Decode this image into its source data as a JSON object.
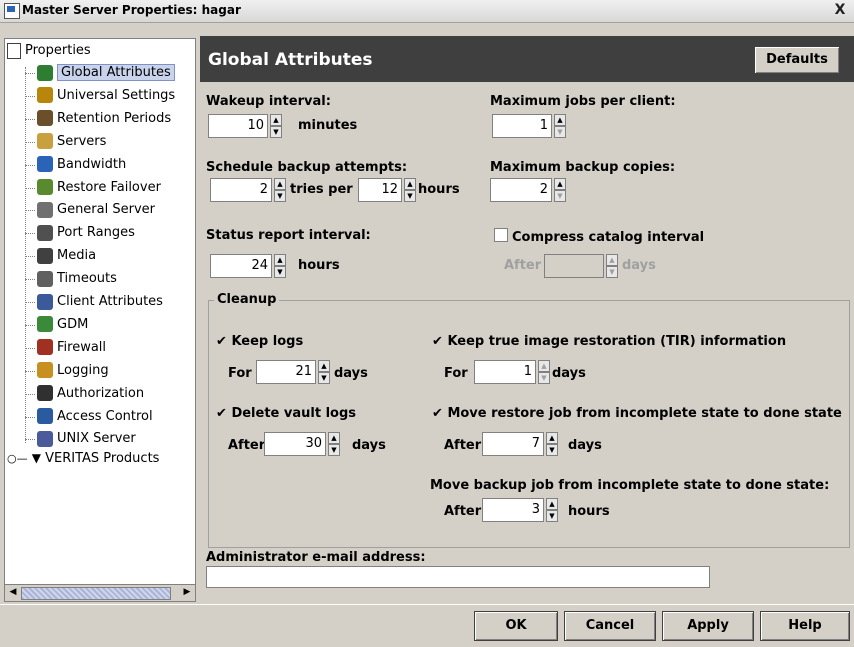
{
  "window": {
    "title": "Master Server Properties: hagar",
    "close_label": "X"
  },
  "tree": {
    "root": "Properties",
    "items": [
      {
        "label": "Global Attributes",
        "icon": "globe-icon",
        "color": "#2e7d32"
      },
      {
        "label": "Universal Settings",
        "icon": "gear-icon",
        "color": "#b8860b"
      },
      {
        "label": "Retention Periods",
        "icon": "clock-icon",
        "color": "#6b4f2a"
      },
      {
        "label": "Servers",
        "icon": "server-icon",
        "color": "#c8a040"
      },
      {
        "label": "Bandwidth",
        "icon": "bandwidth-icon",
        "color": "#2a63b7"
      },
      {
        "label": "Restore Failover",
        "icon": "failover-icon",
        "color": "#5a8a30"
      },
      {
        "label": "General Server",
        "icon": "server-icon",
        "color": "#707070"
      },
      {
        "label": "Port Ranges",
        "icon": "port-icon",
        "color": "#505050"
      },
      {
        "label": "Media",
        "icon": "media-icon",
        "color": "#404040"
      },
      {
        "label": "Timeouts",
        "icon": "timer-icon",
        "color": "#606060"
      },
      {
        "label": "Client Attributes",
        "icon": "client-icon",
        "color": "#3a5a9a"
      },
      {
        "label": "GDM",
        "icon": "gdm-icon",
        "color": "#3a8a3a"
      },
      {
        "label": "Firewall",
        "icon": "firewall-icon",
        "color": "#a03020"
      },
      {
        "label": "Logging",
        "icon": "logging-icon",
        "color": "#c89020"
      },
      {
        "label": "Authorization",
        "icon": "user-icon",
        "color": "#303030"
      },
      {
        "label": "Access Control",
        "icon": "access-icon",
        "color": "#2a5aa0"
      },
      {
        "label": "UNIX Server",
        "icon": "unix-icon",
        "color": "#4a5a9a"
      }
    ],
    "products": "VERITAS Products"
  },
  "panel": {
    "title": "Global Attributes",
    "defaults_button": "Defaults",
    "wakeup": {
      "label": "Wakeup interval:",
      "value": "10",
      "unit": "minutes"
    },
    "max_jobs": {
      "label": "Maximum jobs per client:",
      "value": "1"
    },
    "schedule": {
      "label": "Schedule backup attempts:",
      "tries": "2",
      "tries_unit": "tries per",
      "hours": "12",
      "hours_unit": "hours"
    },
    "max_copies": {
      "label": "Maximum backup copies:",
      "value": "2"
    },
    "status": {
      "label": "Status report interval:",
      "value": "24",
      "unit": "hours"
    },
    "compress": {
      "label": "Compress catalog interval",
      "after": "After",
      "value": "",
      "unit": "days",
      "checked": false
    },
    "cleanup": {
      "legend": "Cleanup",
      "keep_logs": {
        "label": "Keep logs",
        "for": "For",
        "value": "21",
        "unit": "days",
        "checked": true
      },
      "keep_tir": {
        "label": "Keep true image restoration (TIR) information",
        "for": "For",
        "value": "1",
        "unit": "days",
        "checked": true
      },
      "delete_vault": {
        "label": "Delete vault logs",
        "after": "After",
        "value": "30",
        "unit": "days",
        "checked": true
      },
      "move_restore": {
        "label": "Move restore job from incomplete state to done state",
        "after": "After",
        "value": "7",
        "unit": "days",
        "checked": true
      },
      "move_backup": {
        "label": "Move backup job from incomplete state to done state:",
        "after": "After",
        "value": "3",
        "unit": "hours"
      }
    },
    "email": {
      "label": "Administrator e-mail address:",
      "value": ""
    }
  },
  "buttons": {
    "ok": "OK",
    "cancel": "Cancel",
    "apply": "Apply",
    "help": "Help"
  }
}
